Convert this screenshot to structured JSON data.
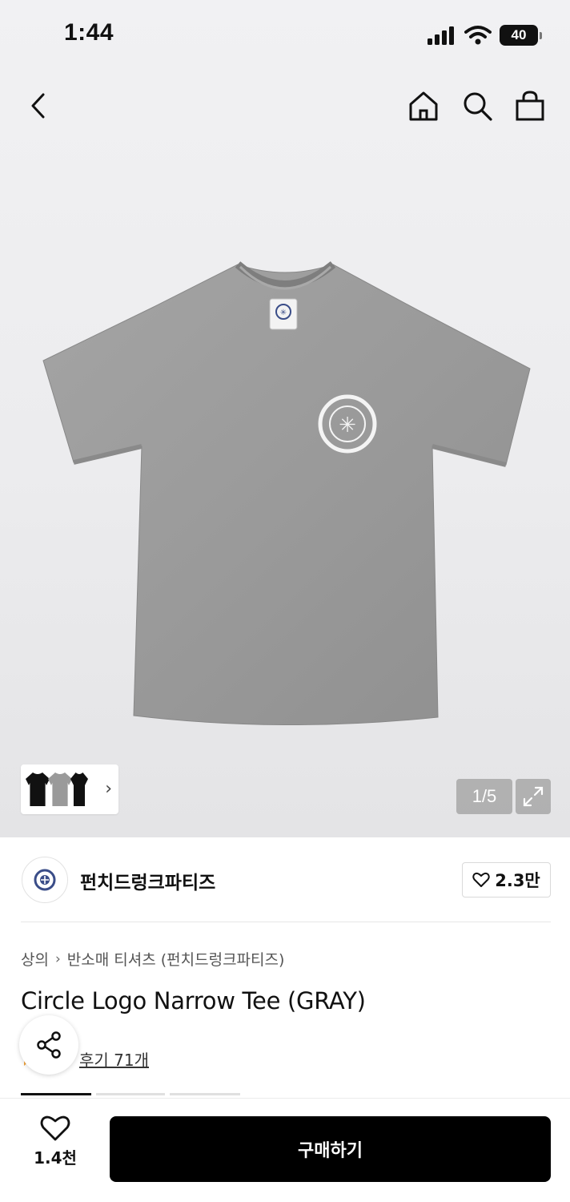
{
  "status_bar": {
    "time": "1:44",
    "battery": "40",
    "icons": [
      "cellular-signal-icon",
      "wifi-icon",
      "battery-icon"
    ]
  },
  "nav": {
    "icons": [
      "back-chevron-icon",
      "home-icon",
      "search-icon",
      "shopping-bag-icon"
    ]
  },
  "gallery": {
    "counter": "1/5",
    "current_page": 1,
    "total_pages": 5,
    "thumbnail_colors": [
      "#111111",
      "#9a9a9a",
      "#111111"
    ]
  },
  "brand": {
    "name": "펀치드렁크파티즈",
    "likes": "2.3만"
  },
  "product": {
    "breadcrumb": [
      "상의",
      "반소매 티셔츠 (펀치드렁크파티즈)"
    ],
    "title": "Circle Logo Narrow Tee (GRAY)",
    "reviews": "후기 71개"
  },
  "bottom_bar": {
    "wishlist_count": "1.4천",
    "buy_label": "구매하기"
  },
  "colors": {
    "shirt": "#9c9c9c",
    "buy_button": "#000000",
    "hero_background": "#efeff1"
  }
}
